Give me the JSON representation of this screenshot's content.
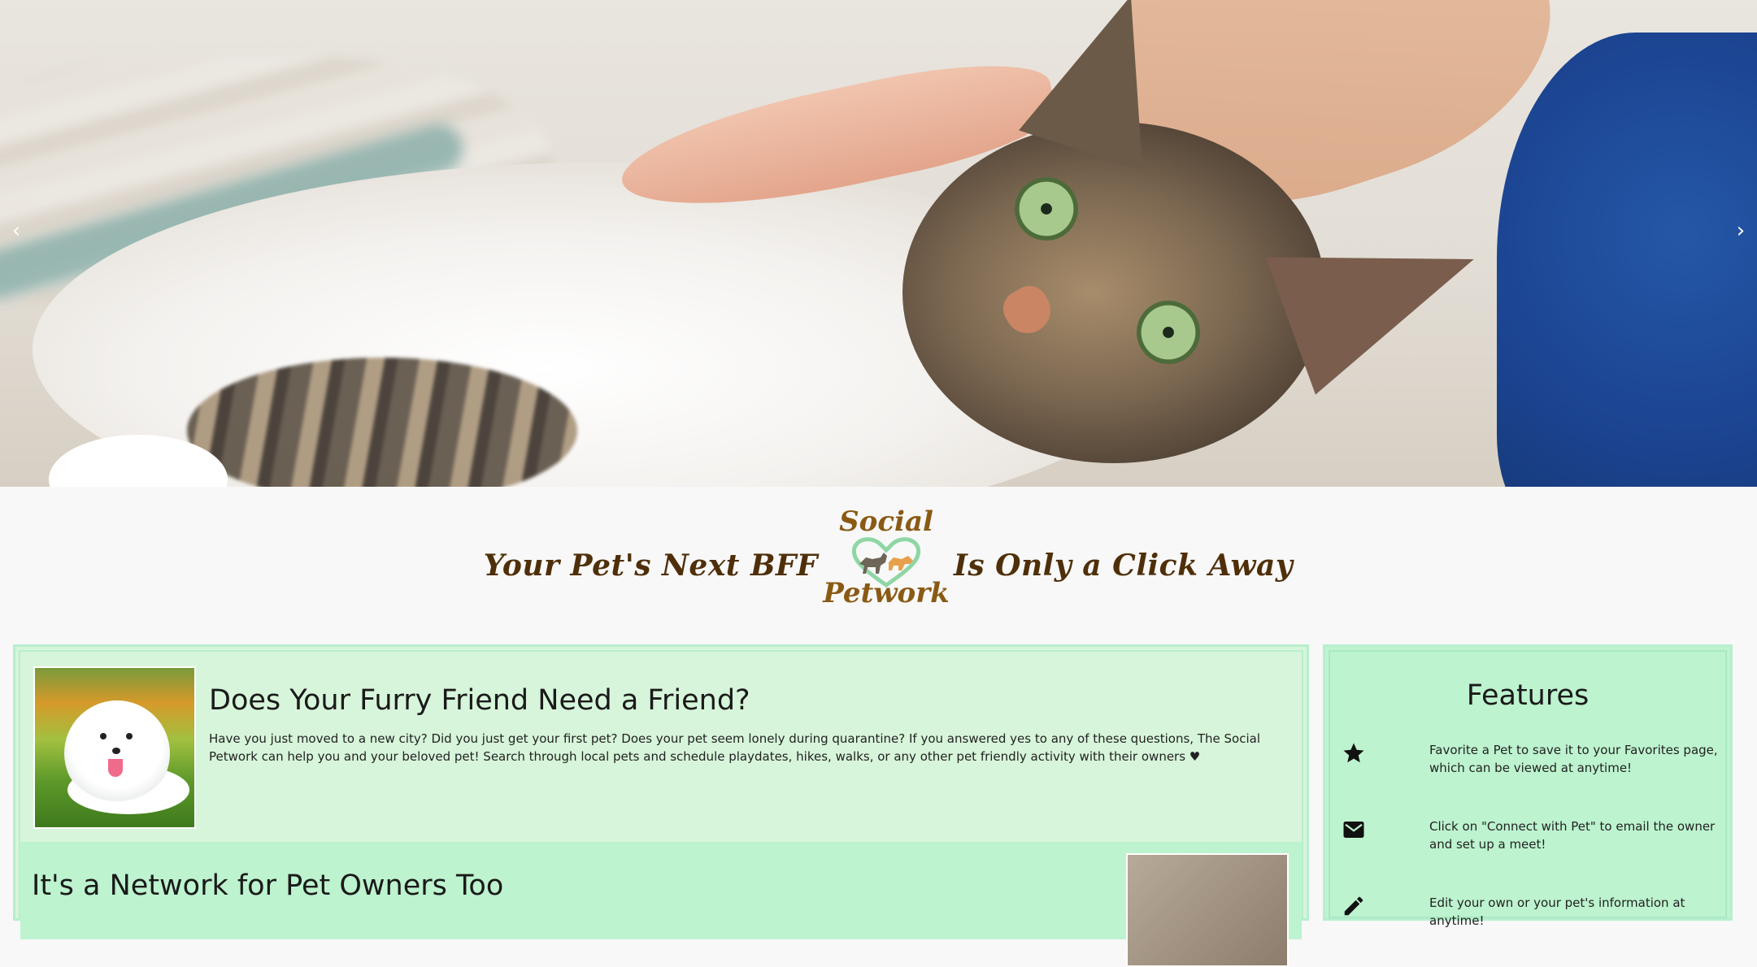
{
  "hero": {
    "prev_icon": "chevron-left-icon",
    "next_icon": "chevron-right-icon",
    "prev_glyph": "‹",
    "next_glyph": "›"
  },
  "tagline": {
    "left": "Your Pet's Next BFF",
    "right": "Is Only a Click Away",
    "logo_top": "Social",
    "logo_bottom": "Petwork"
  },
  "intro": {
    "title": "Does Your Furry Friend Need a Friend?",
    "body": "Have you just moved to a new city? Did you just get your first pet? Does your pet seem lonely during quarantine? If you answered yes to any of these questions, The Social Petwork can help you and your beloved pet! Search through local pets and schedule playdates, hikes, walks, or any other pet friendly activity with their owners ♥"
  },
  "owners": {
    "title": "It's a Network for Pet Owners Too"
  },
  "features": {
    "title": "Features",
    "items": [
      {
        "icon": "star-icon",
        "text": "Favorite a Pet to save it to your Favorites page, which can be viewed at anytime!"
      },
      {
        "icon": "mail-icon",
        "text": "Click on \"Connect with Pet\" to email the owner and set up a meet!"
      },
      {
        "icon": "pencil-icon",
        "text": "Edit your own or your pet's information at anytime!"
      }
    ]
  },
  "colors": {
    "brand_brown": "#4f2f0a",
    "logo_brown": "#8a5a14",
    "light_green": "#d7f5da",
    "mint": "#bdf3cf"
  }
}
